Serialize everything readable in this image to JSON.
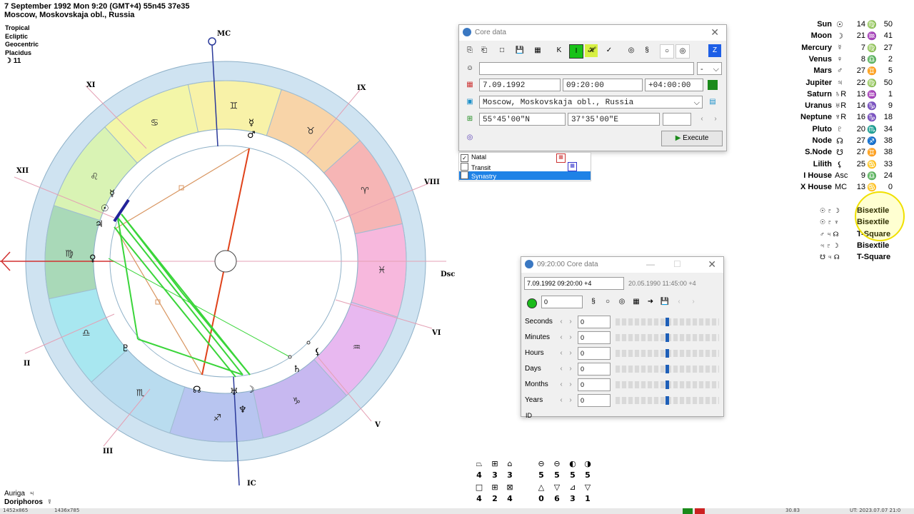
{
  "header": {
    "line1": "7 September 1992  Mon   9:20 (GMT+4) 55n45  37e35",
    "line2": "Moscow, Moskovskaja obl., Russia",
    "options": [
      "Tropical",
      "Ecliptic",
      "Geocentric",
      "Placidus"
    ],
    "moon_day": "☽  11"
  },
  "chart_wheel": {
    "house_labels": [
      {
        "id": "mc",
        "text": "MC"
      },
      {
        "id": "ix",
        "text": "IX"
      },
      {
        "id": "viii",
        "text": "VIII"
      },
      {
        "id": "dsc",
        "text": "Dsc"
      },
      {
        "id": "vi",
        "text": "VI"
      },
      {
        "id": "v",
        "text": "V"
      },
      {
        "id": "ic",
        "text": "IC"
      },
      {
        "id": "iii",
        "text": "III"
      },
      {
        "id": "ii",
        "text": "II"
      },
      {
        "id": "xii",
        "text": "XII"
      },
      {
        "id": "xi",
        "text": "XI"
      }
    ],
    "signs": [
      "♋",
      "♌",
      "♍",
      "♎",
      "♏",
      "♐",
      "♑",
      "♒",
      "♓",
      "♈",
      "♉",
      "♊"
    ]
  },
  "planets": [
    {
      "name": "Sun",
      "glyph": "☉",
      "deg": "14",
      "sign": "♍",
      "min": "50"
    },
    {
      "name": "Moon",
      "glyph": "☽",
      "deg": "21",
      "sign": "♒",
      "min": "41"
    },
    {
      "name": "Mercury",
      "glyph": "☿",
      "deg": "7",
      "sign": "♍",
      "min": "27"
    },
    {
      "name": "Venus",
      "glyph": "♀",
      "deg": "8",
      "sign": "♎",
      "min": "2"
    },
    {
      "name": "Mars",
      "glyph": "♂",
      "deg": "27",
      "sign": "♊",
      "min": "5"
    },
    {
      "name": "Jupiter",
      "glyph": "♃",
      "deg": "22",
      "sign": "♍",
      "min": "50"
    },
    {
      "name": "Saturn",
      "glyph": "♄R",
      "deg": "13",
      "sign": "♒",
      "min": "1"
    },
    {
      "name": "Uranus",
      "glyph": "♅R",
      "deg": "14",
      "sign": "♑",
      "min": "9"
    },
    {
      "name": "Neptune",
      "glyph": "♆R",
      "deg": "16",
      "sign": "♑",
      "min": "18"
    },
    {
      "name": "Pluto",
      "glyph": "♇",
      "deg": "20",
      "sign": "♏",
      "min": "34"
    },
    {
      "name": "Node",
      "glyph": "☊",
      "deg": "27",
      "sign": "♐",
      "min": "38"
    },
    {
      "name": "S.Node",
      "glyph": "☋",
      "deg": "27",
      "sign": "♊",
      "min": "38"
    },
    {
      "name": "Lilith",
      "glyph": "⚸",
      "deg": "25",
      "sign": "♋",
      "min": "33"
    },
    {
      "name": "I House",
      "glyph": "Asc",
      "deg": "9",
      "sign": "♎",
      "min": "24"
    },
    {
      "name": "X House",
      "glyph": "MC",
      "deg": "13",
      "sign": "♋",
      "min": "0"
    }
  ],
  "aspect_patterns": [
    {
      "glyphs": "☉ ♇ ☽",
      "name": "Bisextile"
    },
    {
      "glyphs": "☉ ♇ ♆",
      "name": "Bisextile"
    },
    {
      "glyphs": "♂ ♃ ☊",
      "name": "T-Square"
    },
    {
      "glyphs": "♃ ♇ ☽",
      "name": "Bisextile"
    },
    {
      "glyphs": "☋ ♃ ☊",
      "name": "T-Square"
    }
  ],
  "core_window": {
    "title": "Core data",
    "toolbar": [
      "⎘",
      "⎗",
      "□",
      "💾",
      "▦",
      "K",
      "I",
      "𝓗",
      "✓",
      "◎",
      "§",
      "○",
      "◎",
      "Z"
    ],
    "name_value": "",
    "name_dropdown": "-",
    "date": "7.09.1992",
    "time": "09:20:00",
    "tz": "+04:00:00",
    "place": "Moscow, Moskovskaja obl., Russia",
    "lat": "55°45'00\"N",
    "lon": "37°35'00\"E",
    "execute_label": "Execute"
  },
  "chart_types": [
    {
      "label": "Natal",
      "checked": "✓"
    },
    {
      "label": "Transit",
      "checked": ""
    },
    {
      "label": "Synastry",
      "checked": ""
    }
  ],
  "time_window": {
    "title": "09:20:00 Core data",
    "datetime1": "7.09.1992  09:20:00  +4",
    "datetime2": "20.05.1990   11:45:00  +4",
    "step_value": "0",
    "rows": [
      {
        "label": "Seconds",
        "value": "0"
      },
      {
        "label": "Minutes",
        "value": "0"
      },
      {
        "label": "Hours",
        "value": "0"
      },
      {
        "label": "Days",
        "value": "0"
      },
      {
        "label": "Months",
        "value": "0"
      },
      {
        "label": "Years",
        "value": "0"
      }
    ],
    "last_label": "ID"
  },
  "bottom_counts": {
    "row1": [
      {
        "sym": "⏢",
        "n": "4"
      },
      {
        "sym": "⊞",
        "n": "3"
      },
      {
        "sym": "⌂",
        "n": "3"
      },
      {
        "sym": "⊖",
        "n": "5"
      },
      {
        "sym": "⊖",
        "n": "5"
      },
      {
        "sym": "◐",
        "n": "5"
      },
      {
        "sym": "◑",
        "n": "5"
      }
    ],
    "row2": [
      {
        "sym": "□",
        "n": "4"
      },
      {
        "sym": "⊞",
        "n": "2"
      },
      {
        "sym": "⊠",
        "n": "4"
      },
      {
        "sym": "△",
        "n": "0"
      },
      {
        "sym": "▽",
        "n": "6"
      },
      {
        "sym": "⊿",
        "n": "3"
      },
      {
        "sym": "▽",
        "n": "1"
      }
    ]
  },
  "star_labels": [
    {
      "name": "Auriga",
      "glyph": "♃"
    },
    {
      "name": "Doriphoros",
      "glyph": "☿"
    }
  ],
  "status": {
    "left1": "1452x865",
    "left2": "1436x785",
    "right1": "30.83",
    "right2": "UT: 2023.07.07 21:0"
  }
}
